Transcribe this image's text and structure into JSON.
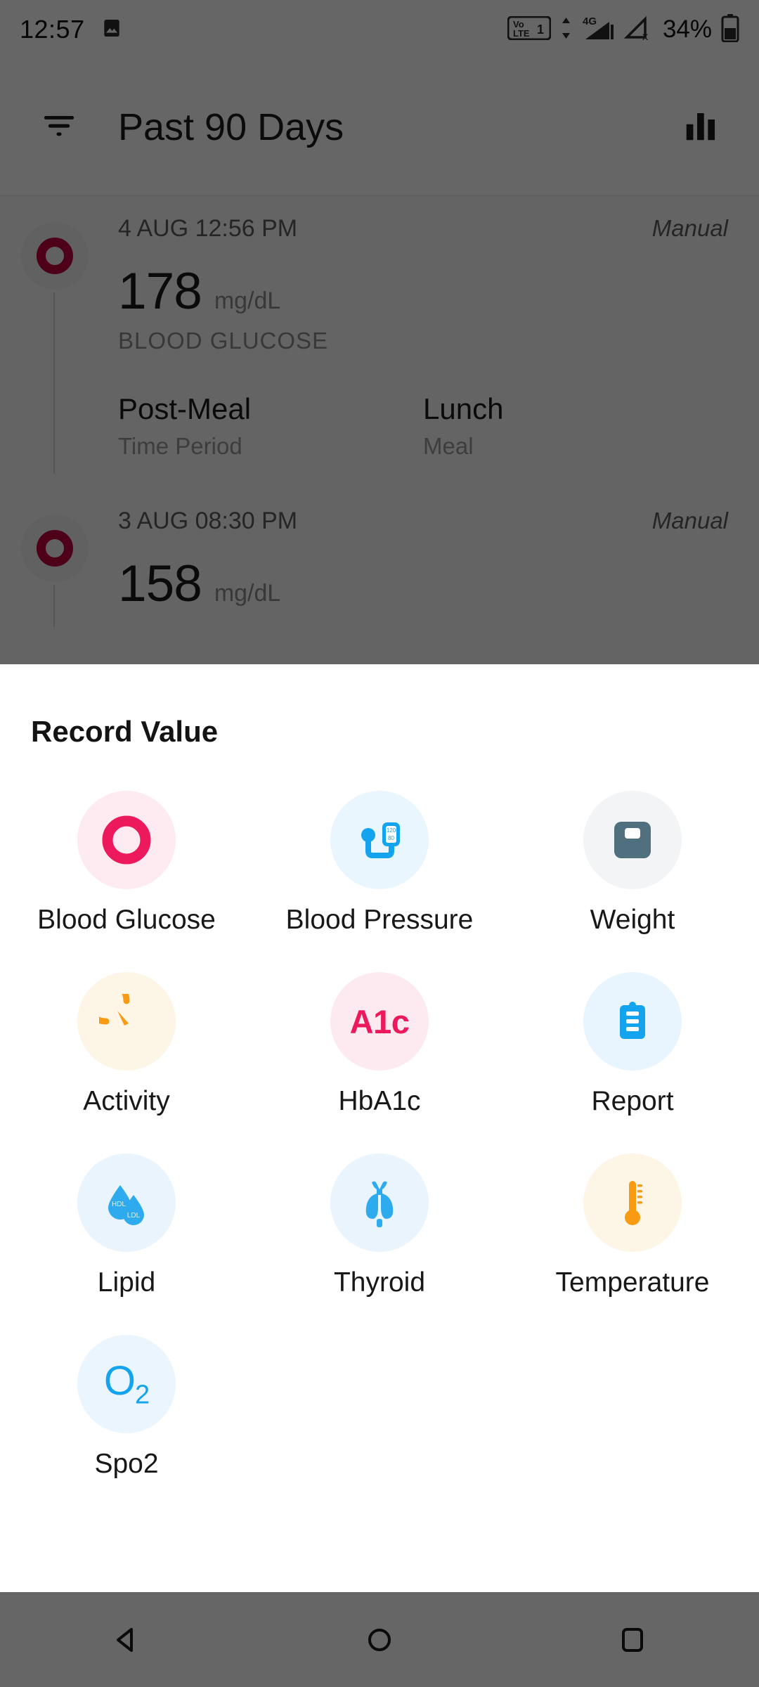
{
  "status_bar": {
    "time": "12:57",
    "gallery_icon": "image-icon",
    "volte_label": "VoLTE",
    "volte_sim": "1",
    "network_label": "4G",
    "battery_percent": "34%"
  },
  "header": {
    "filter_icon": "filter-icon",
    "title": "Past 90 Days",
    "chart_icon": "bar-chart-icon"
  },
  "records": [
    {
      "date": "4 AUG 12:56 PM",
      "source": "Manual",
      "value": "178",
      "unit": "mg/dL",
      "type": "BLOOD GLUCOSE",
      "meta": [
        {
          "value": "Post-Meal",
          "label": "Time Period"
        },
        {
          "value": "Lunch",
          "label": "Meal"
        }
      ]
    },
    {
      "date": "3 AUG 08:30 PM",
      "source": "Manual",
      "value": "158",
      "unit": "mg/dL",
      "type": "",
      "meta": []
    }
  ],
  "sheet": {
    "title": "Record Value",
    "tiles": [
      {
        "label": "Blood Glucose",
        "icon": "blood-glucose-icon",
        "bg": "#fdebf1",
        "accent": "#ec1a5c"
      },
      {
        "label": "Blood Pressure",
        "icon": "blood-pressure-icon",
        "bg": "#eaf6fe",
        "accent": "#13a3ef"
      },
      {
        "label": "Weight",
        "icon": "weight-scale-icon",
        "bg": "#f2f4f5",
        "accent": "#51707f"
      },
      {
        "label": "Activity",
        "icon": "activity-gauge-icon",
        "bg": "#fdf5e6",
        "accent": "#f89a12"
      },
      {
        "label": "HbA1c",
        "icon": "hba1c-icon",
        "bg": "#fdeaf1",
        "accent": "#ec1a5c"
      },
      {
        "label": "Report",
        "icon": "report-clipboard-icon",
        "bg": "#e9f5fe",
        "accent": "#13a3ef"
      },
      {
        "label": "Lipid",
        "icon": "lipid-droplets-icon",
        "bg": "#eaf4fd",
        "accent": "#2eaaef"
      },
      {
        "label": "Thyroid",
        "icon": "thyroid-gland-icon",
        "bg": "#eaf4fd",
        "accent": "#2eaaef"
      },
      {
        "label": "Temperature",
        "icon": "thermometer-icon",
        "bg": "#fdf5e6",
        "accent": "#f89a12"
      },
      {
        "label": "Spo2",
        "icon": "spo2-icon",
        "bg": "#eaf5fd",
        "accent": "#13a3ef"
      }
    ],
    "lipid_hdl": "HDL",
    "lipid_ldl": "LDL",
    "bp_systolic": "120",
    "bp_diastolic": "80",
    "a1c_text": "A1c",
    "o2_symbol": "O",
    "o2_sub": "2"
  },
  "nav_bar": {
    "back": "back-triangle-icon",
    "home": "home-circle-icon",
    "recents": "recents-square-icon"
  }
}
